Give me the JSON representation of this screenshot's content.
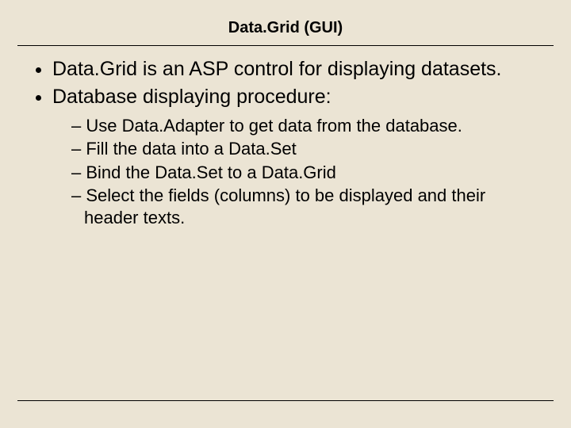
{
  "title": "Data.Grid (GUI)",
  "bullets": {
    "b0": "Data.Grid is an ASP control for displaying datasets.",
    "b1": "Database displaying procedure:"
  },
  "sub": {
    "s0": "Use Data.Adapter to get data from the database.",
    "s1": "Fill the data into a Data.Set",
    "s2": "Bind the Data.Set to a Data.Grid",
    "s3": "Select the fields (columns) to be displayed and their header texts."
  }
}
